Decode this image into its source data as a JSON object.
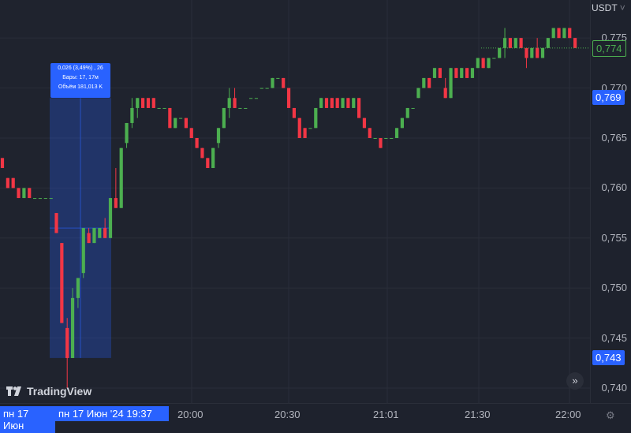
{
  "currency": "USDT",
  "currency_chevron": "˅",
  "brand": "TradingView",
  "measure": {
    "line1": "0,026 (3,49%) , 26",
    "line2": "Бары: 17, 17м",
    "line3": "Объём 181,013 K"
  },
  "price_tags": {
    "last": "0,774",
    "range_high": "0,769",
    "range_low": "0,743"
  },
  "time_labels": {
    "range_start": "пн 17 Июн",
    "range_end": "пн 17 Июн '24",
    "range_end_time": "19:37"
  },
  "icons": {
    "scroll": "scroll-right-icon",
    "settings": "settings-gear-icon",
    "logo": "tradingview-logo-icon"
  },
  "colors": {
    "up": "#26a69a",
    "up_candle": "#4caf50",
    "down": "#f23645",
    "accent": "#2962ff",
    "background": "#1f232e",
    "grid": "#2a2e39"
  },
  "chart_data": {
    "type": "candlestick",
    "symbol_quote": "USDT",
    "y_ticks": [
      "0,775",
      "0,770",
      "0,765",
      "0,760",
      "0,755",
      "0,750",
      "0,745",
      "0,740"
    ],
    "x_ticks": [
      "20:00",
      "20:30",
      "21:01",
      "21:30",
      "22:00"
    ],
    "ylim": [
      0.7385,
      0.7788
    ],
    "grid": true,
    "last_price": 0.774,
    "measured_range": {
      "high": 0.769,
      "low": 0.743,
      "change": 0.026,
      "change_pct": "3,49%",
      "bars": 17,
      "duration": "17м",
      "volume": "181,013 K"
    },
    "candles": [
      [
        0.763,
        0.763,
        0.762,
        0.762
      ],
      [
        0.761,
        0.761,
        0.76,
        0.76
      ],
      [
        0.761,
        0.761,
        0.76,
        0.76
      ],
      [
        0.76,
        0.76,
        0.759,
        0.759
      ],
      [
        0.759,
        0.76,
        0.759,
        0.76
      ],
      [
        0.76,
        0.76,
        0.759,
        0.759
      ],
      [
        0.759,
        0.759,
        0.759,
        0.759
      ],
      [
        0.759,
        0.759,
        0.759,
        0.759
      ],
      [
        0.759,
        0.759,
        0.759,
        0.759
      ],
      [
        0.759,
        0.759,
        0.759,
        0.759
      ],
      [
        0.7575,
        0.7575,
        0.7555,
        0.7555
      ],
      [
        0.7545,
        0.7545,
        0.7465,
        0.7465
      ],
      [
        0.746,
        0.747,
        0.74,
        0.743
      ],
      [
        0.743,
        0.75,
        0.743,
        0.749
      ],
      [
        0.749,
        0.751,
        0.748,
        0.751
      ],
      [
        0.7515,
        0.756,
        0.751,
        0.756
      ],
      [
        0.7555,
        0.756,
        0.7545,
        0.7545
      ],
      [
        0.7545,
        0.756,
        0.7545,
        0.756
      ],
      [
        0.755,
        0.756,
        0.755,
        0.756
      ],
      [
        0.756,
        0.757,
        0.755,
        0.755
      ],
      [
        0.755,
        0.759,
        0.755,
        0.759
      ],
      [
        0.759,
        0.762,
        0.758,
        0.758
      ],
      [
        0.758,
        0.764,
        0.758,
        0.764
      ],
      [
        0.7645,
        0.7665,
        0.764,
        0.7665
      ],
      [
        0.7665,
        0.769,
        0.766,
        0.768
      ],
      [
        0.768,
        0.769,
        0.767,
        0.769
      ],
      [
        0.769,
        0.769,
        0.768,
        0.768
      ],
      [
        0.769,
        0.769,
        0.768,
        0.768
      ],
      [
        0.769,
        0.769,
        0.768,
        0.768
      ],
      [
        0.768,
        0.768,
        0.768,
        0.768
      ],
      [
        0.768,
        0.768,
        0.768,
        0.768
      ],
      [
        0.768,
        0.768,
        0.766,
        0.766
      ],
      [
        0.766,
        0.767,
        0.766,
        0.767
      ],
      [
        0.767,
        0.767,
        0.767,
        0.767
      ],
      [
        0.767,
        0.767,
        0.766,
        0.766
      ],
      [
        0.766,
        0.766,
        0.765,
        0.765
      ],
      [
        0.765,
        0.765,
        0.764,
        0.764
      ],
      [
        0.764,
        0.764,
        0.763,
        0.763
      ],
      [
        0.763,
        0.763,
        0.762,
        0.762
      ],
      [
        0.762,
        0.764,
        0.762,
        0.764
      ],
      [
        0.7645,
        0.766,
        0.764,
        0.766
      ],
      [
        0.766,
        0.768,
        0.766,
        0.768
      ],
      [
        0.768,
        0.77,
        0.767,
        0.769
      ],
      [
        0.769,
        0.77,
        0.768,
        0.768
      ],
      [
        0.768,
        0.768,
        0.768,
        0.768
      ],
      [
        0.768,
        0.768,
        0.768,
        0.768
      ],
      [
        0.769,
        0.769,
        0.769,
        0.769
      ],
      [
        0.769,
        0.769,
        0.769,
        0.769
      ],
      [
        0.77,
        0.77,
        0.77,
        0.77
      ],
      [
        0.77,
        0.77,
        0.77,
        0.77
      ],
      [
        0.77,
        0.771,
        0.77,
        0.771
      ],
      [
        0.771,
        0.771,
        0.771,
        0.771
      ],
      [
        0.771,
        0.771,
        0.77,
        0.77
      ],
      [
        0.77,
        0.77,
        0.768,
        0.768
      ],
      [
        0.768,
        0.768,
        0.767,
        0.767
      ],
      [
        0.767,
        0.767,
        0.765,
        0.765
      ],
      [
        0.766,
        0.766,
        0.765,
        0.765
      ],
      [
        0.766,
        0.766,
        0.766,
        0.766
      ],
      [
        0.766,
        0.768,
        0.766,
        0.768
      ],
      [
        0.768,
        0.769,
        0.768,
        0.769
      ],
      [
        0.769,
        0.769,
        0.768,
        0.768
      ],
      [
        0.769,
        0.769,
        0.768,
        0.768
      ],
      [
        0.769,
        0.769,
        0.768,
        0.768
      ],
      [
        0.768,
        0.769,
        0.768,
        0.769
      ],
      [
        0.769,
        0.769,
        0.768,
        0.768
      ],
      [
        0.768,
        0.769,
        0.768,
        0.769
      ],
      [
        0.769,
        0.769,
        0.767,
        0.767
      ],
      [
        0.767,
        0.767,
        0.766,
        0.766
      ],
      [
        0.766,
        0.766,
        0.765,
        0.765
      ],
      [
        0.765,
        0.765,
        0.765,
        0.765
      ],
      [
        0.765,
        0.765,
        0.764,
        0.764
      ],
      [
        0.765,
        0.765,
        0.765,
        0.765
      ],
      [
        0.765,
        0.765,
        0.765,
        0.765
      ],
      [
        0.765,
        0.766,
        0.765,
        0.766
      ],
      [
        0.766,
        0.767,
        0.766,
        0.767
      ],
      [
        0.767,
        0.768,
        0.767,
        0.768
      ],
      [
        0.768,
        0.768,
        0.768,
        0.768
      ],
      [
        0.769,
        0.77,
        0.769,
        0.77
      ],
      [
        0.77,
        0.771,
        0.77,
        0.771
      ],
      [
        0.771,
        0.771,
        0.77,
        0.77
      ],
      [
        0.771,
        0.772,
        0.771,
        0.772
      ],
      [
        0.772,
        0.772,
        0.771,
        0.771
      ],
      [
        0.77,
        0.771,
        0.769,
        0.769
      ],
      [
        0.769,
        0.772,
        0.769,
        0.772
      ],
      [
        0.772,
        0.772,
        0.771,
        0.771
      ],
      [
        0.771,
        0.772,
        0.771,
        0.772
      ],
      [
        0.772,
        0.772,
        0.771,
        0.771
      ],
      [
        0.771,
        0.772,
        0.771,
        0.772
      ],
      [
        0.772,
        0.773,
        0.772,
        0.773
      ],
      [
        0.773,
        0.773,
        0.772,
        0.772
      ],
      [
        0.772,
        0.773,
        0.772,
        0.773
      ],
      [
        0.773,
        0.773,
        0.773,
        0.773
      ],
      [
        0.773,
        0.774,
        0.773,
        0.774
      ],
      [
        0.774,
        0.776,
        0.773,
        0.775
      ],
      [
        0.775,
        0.775,
        0.774,
        0.774
      ],
      [
        0.774,
        0.775,
        0.774,
        0.775
      ],
      [
        0.775,
        0.775,
        0.774,
        0.774
      ],
      [
        0.774,
        0.774,
        0.772,
        0.773
      ],
      [
        0.773,
        0.774,
        0.773,
        0.774
      ],
      [
        0.774,
        0.775,
        0.773,
        0.773
      ],
      [
        0.773,
        0.774,
        0.773,
        0.774
      ],
      [
        0.774,
        0.775,
        0.774,
        0.775
      ],
      [
        0.775,
        0.776,
        0.775,
        0.776
      ],
      [
        0.776,
        0.776,
        0.775,
        0.775
      ],
      [
        0.775,
        0.776,
        0.775,
        0.776
      ],
      [
        0.776,
        0.776,
        0.775,
        0.775
      ],
      [
        0.775,
        0.775,
        0.774,
        0.774
      ]
    ]
  }
}
